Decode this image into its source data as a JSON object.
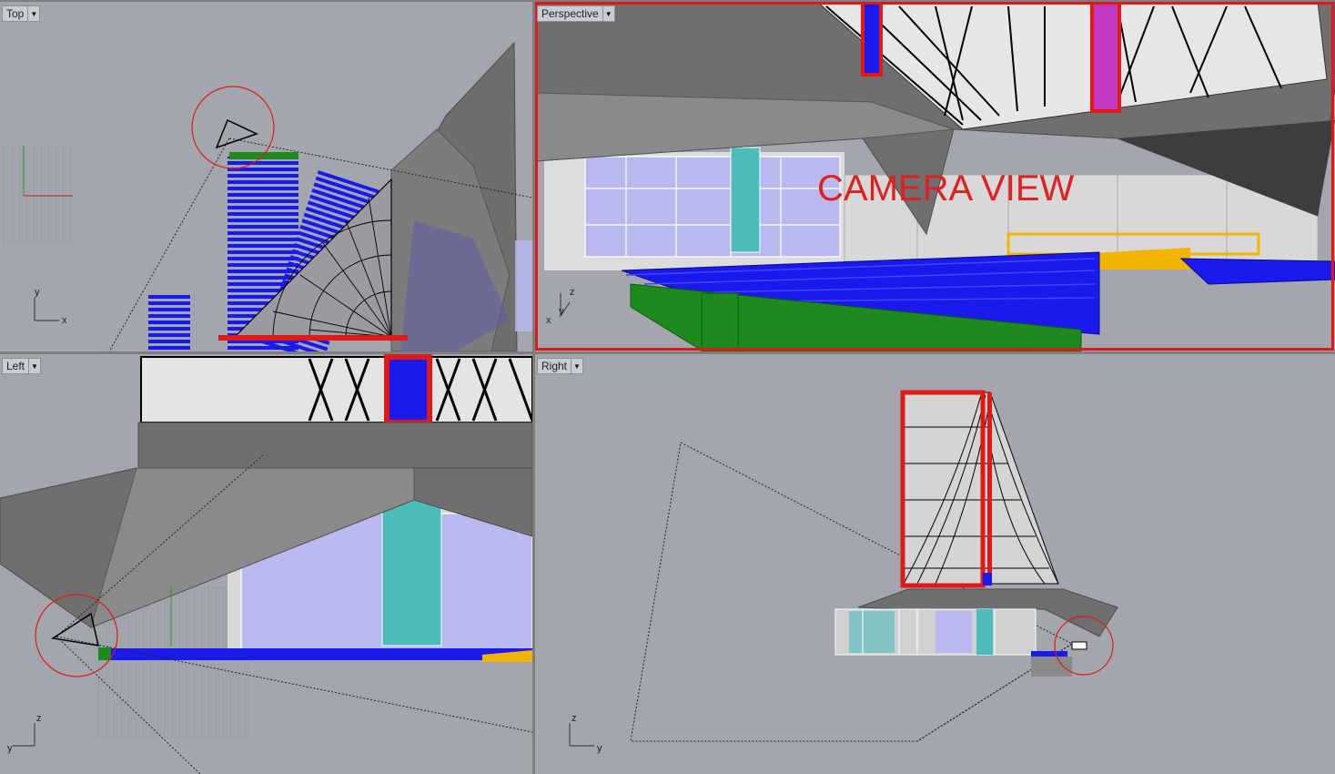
{
  "viewports": {
    "top": {
      "title": "Top",
      "axis_x": "x",
      "axis_y": "y"
    },
    "perspective": {
      "title": "Perspective",
      "axis_x": "x",
      "axis_y": "y",
      "axis_z": "z",
      "annotation": "CAMERA VIEW"
    },
    "left": {
      "title": "Left",
      "axis_y": "y",
      "axis_z": "z"
    },
    "right": {
      "title": "Right",
      "axis_y": "y",
      "axis_z": "z"
    }
  },
  "icons": {
    "dropdown": "chevron-down-icon",
    "camera": "camera-icon"
  },
  "colors": {
    "viewport_bg": "#a3a7ad",
    "seats": "#1a1aee",
    "rail": "#1e8a1e",
    "highlight": "#e01818",
    "stage": "#f2b400",
    "glass": "#b9b9ef",
    "teal": "#4fbcbc",
    "roof": "#6f6f6f"
  }
}
